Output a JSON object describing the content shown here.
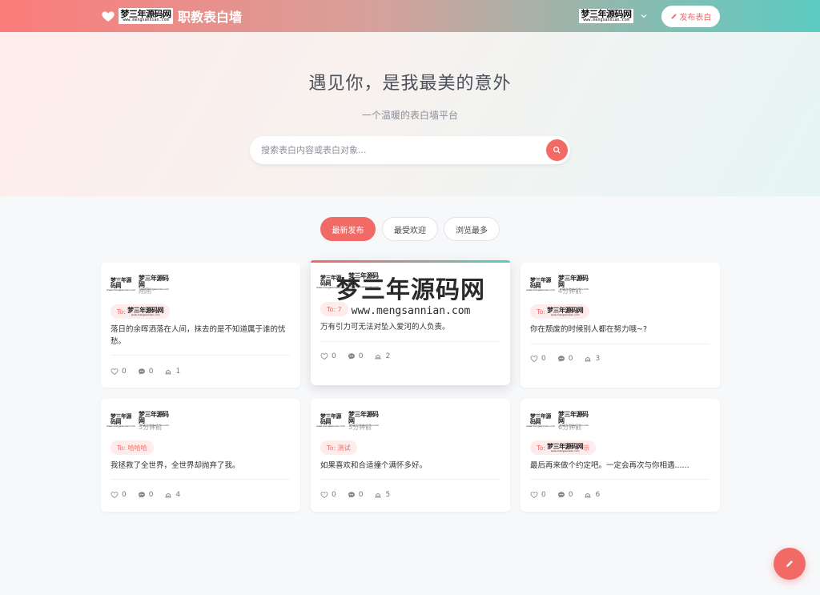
{
  "header": {
    "logo_line1": "梦三年源码网",
    "logo_line2": "www.mengsannian.com",
    "site_name": "职教表白墙",
    "user_logo_line1": "梦三年源码网",
    "user_logo_line2": "www.mengsannian.com",
    "publish_label": "发布表白"
  },
  "hero": {
    "title": "遇见你，是我最美的意外",
    "subtitle": "一个温暖的表白墙平台",
    "search_placeholder": "搜索表白内容或表白对象..."
  },
  "tabs": [
    {
      "label": "最新发布",
      "active": true
    },
    {
      "label": "最受欢迎",
      "active": false
    },
    {
      "label": "浏览最多",
      "active": false
    }
  ],
  "watermark": {
    "line1": "梦三年源码网",
    "line2": "www.mengsannian.com"
  },
  "brand_logo": {
    "line1": "梦三年源码网",
    "line2": "www.mengsannian.com"
  },
  "cards": [
    {
      "time": "刚刚",
      "to_prefix": "To:",
      "to_text": "",
      "to_suffix": "",
      "content": "落日的余晖洒落在人间，抹去的是不知道属于谁的忧愁。",
      "likes": "0",
      "comments": "0",
      "views": "1"
    },
    {
      "time": "",
      "to_prefix": "To: 7",
      "to_text": "",
      "to_suffix": "",
      "content": "万有引力可无法对坠入爱河的人负责。",
      "likes": "0",
      "comments": "0",
      "views": "2"
    },
    {
      "time": "4分钟前",
      "to_prefix": "To:",
      "to_text": "",
      "to_suffix": "",
      "content": "你在颓废的时候别人都在努力哦~?",
      "likes": "0",
      "comments": "0",
      "views": "3"
    },
    {
      "time": "5分钟前",
      "to_prefix": "To: 哈哈哈",
      "to_text": "",
      "to_suffix": "",
      "content": "我拯救了全世界，全世界却抛弃了我。",
      "likes": "0",
      "comments": "0",
      "views": "4"
    },
    {
      "time": "5分钟前",
      "to_prefix": "To: 测试",
      "to_text": "",
      "to_suffix": "",
      "content": "如果喜欢和合适撞个满怀多好。",
      "likes": "0",
      "comments": "0",
      "views": "5"
    },
    {
      "time": "6分钟前",
      "to_prefix": "To:",
      "to_text": "",
      "to_suffix": "示",
      "content": "最后再来做个约定吧。一定会再次与你相遇......",
      "likes": "0",
      "comments": "0",
      "views": "6"
    }
  ]
}
